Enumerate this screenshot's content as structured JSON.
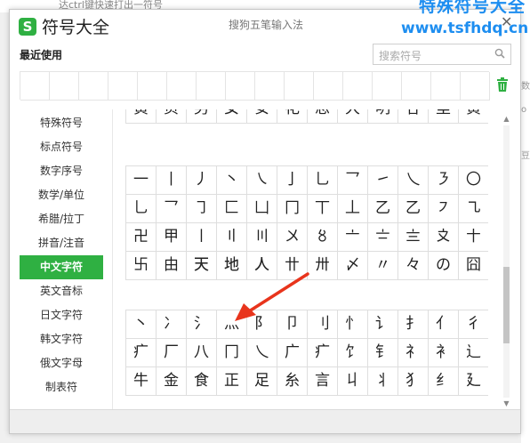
{
  "background": {
    "top_text": "达ctrl键快速打出一符号",
    "right_text": [
      "数",
      "o",
      "豆"
    ]
  },
  "window": {
    "logo_letter": "S",
    "title": "符号大全",
    "subtitle": "搜狗五笔输入法",
    "close_glyph": "✕",
    "accent_color": "#2fb042"
  },
  "watermark": {
    "line1": "特殊符号大全",
    "line2": "www.tsfhdq.cn",
    "color": "#1e8ef0"
  },
  "recent": {
    "label": "最近使用",
    "trash_icon": "trash-icon"
  },
  "search": {
    "placeholder": "搜索符号",
    "icon": "search-icon"
  },
  "sidebar": {
    "items": [
      {
        "label": "特殊符号"
      },
      {
        "label": "标点符号"
      },
      {
        "label": "数字序号"
      },
      {
        "label": "数学/单位"
      },
      {
        "label": "希腊/拉丁"
      },
      {
        "label": "拼音/注音"
      },
      {
        "label": "中文字符",
        "active": true
      },
      {
        "label": "英文音标"
      },
      {
        "label": "日文字符"
      },
      {
        "label": "韩文字符"
      },
      {
        "label": "俄文字母"
      },
      {
        "label": "制表符"
      }
    ]
  },
  "groups": [
    {
      "rows": [
        [
          "黄",
          "页",
          "男",
          "女",
          "安",
          "花",
          "思",
          "大",
          "明",
          "谷",
          "里",
          "黄"
        ]
      ]
    },
    {
      "rows": [
        [
          "一",
          "丨",
          "丿",
          "丶",
          "㇏",
          "亅",
          "乚",
          "乛",
          "㇀",
          "乀",
          "㇋",
          "〇"
        ],
        [
          "乚",
          "乛",
          "㇆",
          "匚",
          "凵",
          "冂",
          "丅",
          "丄",
          "乙",
          "乙",
          "㇇",
          "㇈"
        ],
        [
          "卍",
          "甲",
          "〡",
          "〢",
          "〣",
          "〤",
          "〥",
          "〦",
          "〧",
          "〨",
          "〩",
          "〸"
        ],
        [
          "卐",
          "由",
          "㆝",
          "㆞",
          "㆟",
          "〹",
          "〺",
          "〆",
          "〃",
          "々",
          "の",
          "囧"
        ]
      ]
    },
    {
      "rows": [
        [
          "丶",
          "冫",
          "氵",
          "灬",
          "阝",
          "卩",
          "刂",
          "忄",
          "讠",
          "扌",
          "亻",
          "彳"
        ],
        [
          "疒",
          "厂",
          "八",
          "冂",
          "乀",
          "广",
          "疒",
          "饣",
          "钅",
          "礻",
          "衤",
          "辶"
        ],
        [
          "牛",
          "金",
          "食",
          "正",
          "足",
          "糸",
          "言",
          "丩",
          "丬",
          "犭",
          "纟",
          "廴"
        ]
      ]
    }
  ],
  "scrollbar": {
    "up_glyph": "▲",
    "down_glyph": "▼",
    "thumb_top_fraction": 0.52,
    "thumb_size_fraction": 0.28
  },
  "annotation": {
    "arrow_color": "#e8341c"
  }
}
